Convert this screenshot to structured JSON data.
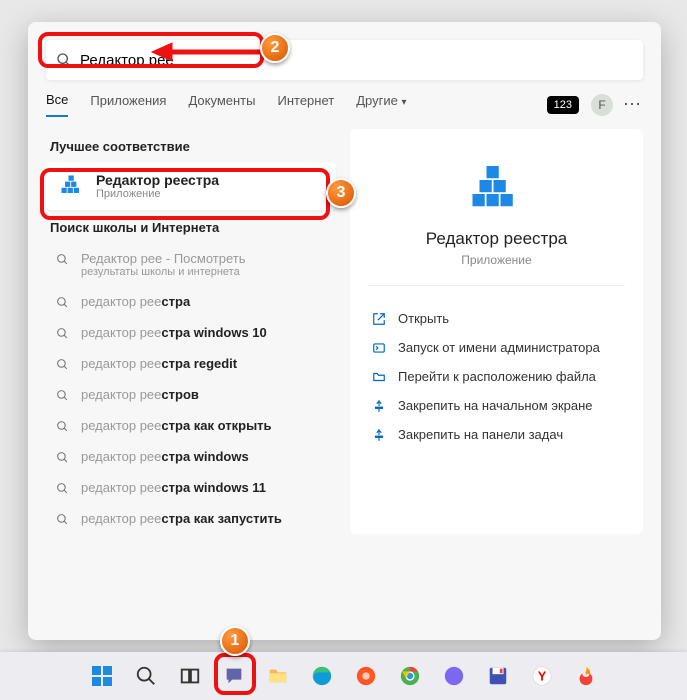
{
  "search": {
    "value": "Редактор рее"
  },
  "tabs": {
    "all": "Все",
    "apps": "Приложения",
    "docs": "Документы",
    "web": "Интернет",
    "other": "Другие"
  },
  "badge": "123",
  "avatar_letter": "F",
  "best_header": "Лучшее соответствие",
  "best": {
    "title": "Редактор реестра",
    "subtitle": "Приложение"
  },
  "school_header": "Поиск школы и Интернета",
  "suggestions": [
    {
      "prefix": "Редактор рее",
      "rest": "",
      "tail": " - Посмотреть",
      "sub": "результаты школы и интернета"
    },
    {
      "prefix": "редактор рее",
      "rest": "стра",
      "tail": "",
      "sub": ""
    },
    {
      "prefix": "редактор рее",
      "rest": "стра windows 10",
      "tail": "",
      "sub": ""
    },
    {
      "prefix": "редактор рее",
      "rest": "стра regedit",
      "tail": "",
      "sub": ""
    },
    {
      "prefix": "редактор рее",
      "rest": "стров",
      "tail": "",
      "sub": ""
    },
    {
      "prefix": "редактор рее",
      "rest": "стра как открыть",
      "tail": "",
      "sub": ""
    },
    {
      "prefix": "редактор рее",
      "rest": "стра windows",
      "tail": "",
      "sub": ""
    },
    {
      "prefix": "редактор рее",
      "rest": "стра windows 11",
      "tail": "",
      "sub": ""
    },
    {
      "prefix": "редактор рее",
      "rest": "стра как запустить",
      "tail": "",
      "sub": ""
    }
  ],
  "detail": {
    "title": "Редактор реестра",
    "subtitle": "Приложение"
  },
  "actions": {
    "open": "Открыть",
    "admin": "Запуск от имени администратора",
    "loc": "Перейти к расположению файла",
    "pin_start": "Закрепить на начальном экране",
    "pin_tb": "Закрепить на панели задач"
  },
  "annotations": {
    "n1": "1",
    "n2": "2",
    "n3": "3"
  }
}
